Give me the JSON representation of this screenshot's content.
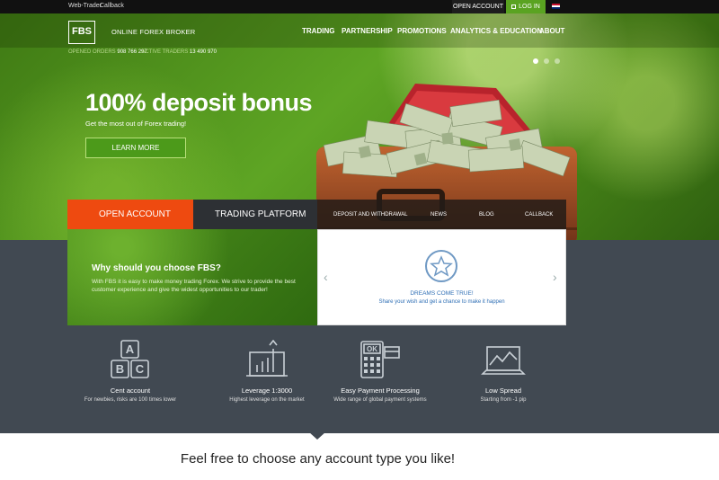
{
  "topbar": {
    "web_trader": "Web-Trader",
    "callback": "Callback",
    "open_account": "OPEN ACCOUNT",
    "login": "LOG IN"
  },
  "header": {
    "logo": "FBS",
    "tagline": "ONLINE FOREX BROKER",
    "nav": [
      "TRADING",
      "PARTNERSHIP",
      "PROMOTIONS",
      "ANALYTICS & EDUCATION",
      "ABOUT"
    ],
    "stats": {
      "orders_label": "OPENED ORDERS",
      "orders_value": "908 766 297",
      "traders_label": "ACTIVE TRADERS",
      "traders_value": "13 490 970"
    }
  },
  "hero": {
    "title": "100% deposit bonus",
    "subtitle": "Get the most out of Forex trading!",
    "button": "LEARN MORE"
  },
  "tabs": {
    "open_account": "OPEN ACCOUNT",
    "trading_platform": "TRADING PLATFORM",
    "links": [
      "DEPOSIT AND WITHDRAWAL",
      "NEWS",
      "BLOG",
      "CALLBACK"
    ]
  },
  "why": {
    "title": "Why should you choose FBS?",
    "text": "With FBS it is easy to make money trading Forex. We strive to provide the best customer experience and give the widest opportunities to our trader!"
  },
  "dream": {
    "title": "DREAMS COME TRUE!",
    "text": "Share your wish and get a chance to make it happen"
  },
  "features": [
    {
      "title": "Cent account",
      "sub": "For newbies, risks are 100 times lower",
      "icon": "abc-blocks-icon"
    },
    {
      "title": "Leverage 1:3000",
      "sub": "Highest leverage on the market",
      "icon": "leverage-chart-icon"
    },
    {
      "title": "Easy Payment Processing",
      "sub": "Wide range of global payment systems",
      "icon": "payment-terminal-icon"
    },
    {
      "title": "Low Spread",
      "sub": "Starting from -1 pip",
      "icon": "laptop-chart-icon"
    }
  ],
  "bottom": {
    "title": "Feel free to choose any account type you like!"
  },
  "colors": {
    "accent_orange": "#ee4a10",
    "brand_green": "#5aa321",
    "dark_band": "#414952"
  }
}
